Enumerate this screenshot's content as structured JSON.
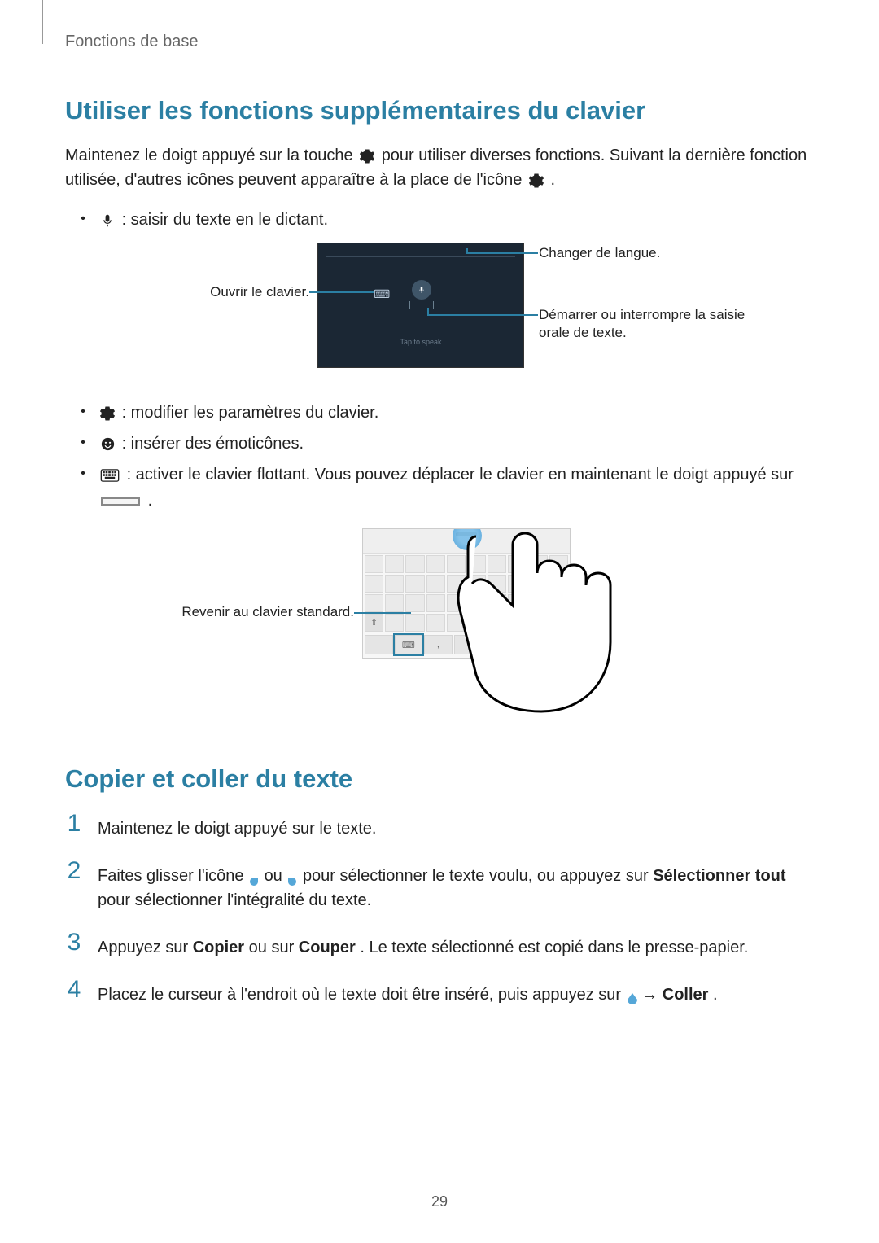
{
  "breadcrumb": "Fonctions de base",
  "section1": {
    "heading": "Utiliser les fonctions supplémentaires du clavier",
    "intro_part1": "Maintenez le doigt appuyé sur la touche ",
    "intro_part2": " pour utiliser diverses fonctions. Suivant la dernière fonction utilisée, d'autres icônes peuvent apparaître à la place de l'icône ",
    "intro_part3": ".",
    "bullets": {
      "mic": " : saisir du texte en le dictant.",
      "gear": " : modifier les paramètres du clavier.",
      "emoji": " : insérer des émoticônes.",
      "float1": " : activer le clavier flottant. Vous pouvez déplacer le clavier en maintenant le doigt appuyé sur ",
      "float2": " ."
    }
  },
  "fig1": {
    "left1": "Ouvrir le clavier.",
    "right1": "Changer de langue.",
    "right2": "Démarrer ou interrompre la saisie orale de texte.",
    "tap_to_speak": "Tap to speak"
  },
  "fig2": {
    "left1": "Revenir au clavier standard."
  },
  "section2": {
    "heading": "Copier et coller du texte",
    "step1": "Maintenez le doigt appuyé sur le texte.",
    "step2_a": "Faites glisser l'icône ",
    "step2_b": " ou ",
    "step2_c": " pour sélectionner le texte voulu, ou appuyez sur ",
    "step2_bold": "Sélectionner tout",
    "step2_d": " pour sélectionner l'intégralité du texte.",
    "step3_a": "Appuyez sur ",
    "step3_bold1": "Copier",
    "step3_b": " ou sur ",
    "step3_bold2": "Couper",
    "step3_c": ". Le texte sélectionné est copié dans le presse-papier.",
    "step4_a": "Placez le curseur à l'endroit où le texte doit être inséré, puis appuyez sur ",
    "step4_arrow": " → ",
    "step4_bold": "Coller",
    "step4_b": "."
  },
  "page_number": "29"
}
